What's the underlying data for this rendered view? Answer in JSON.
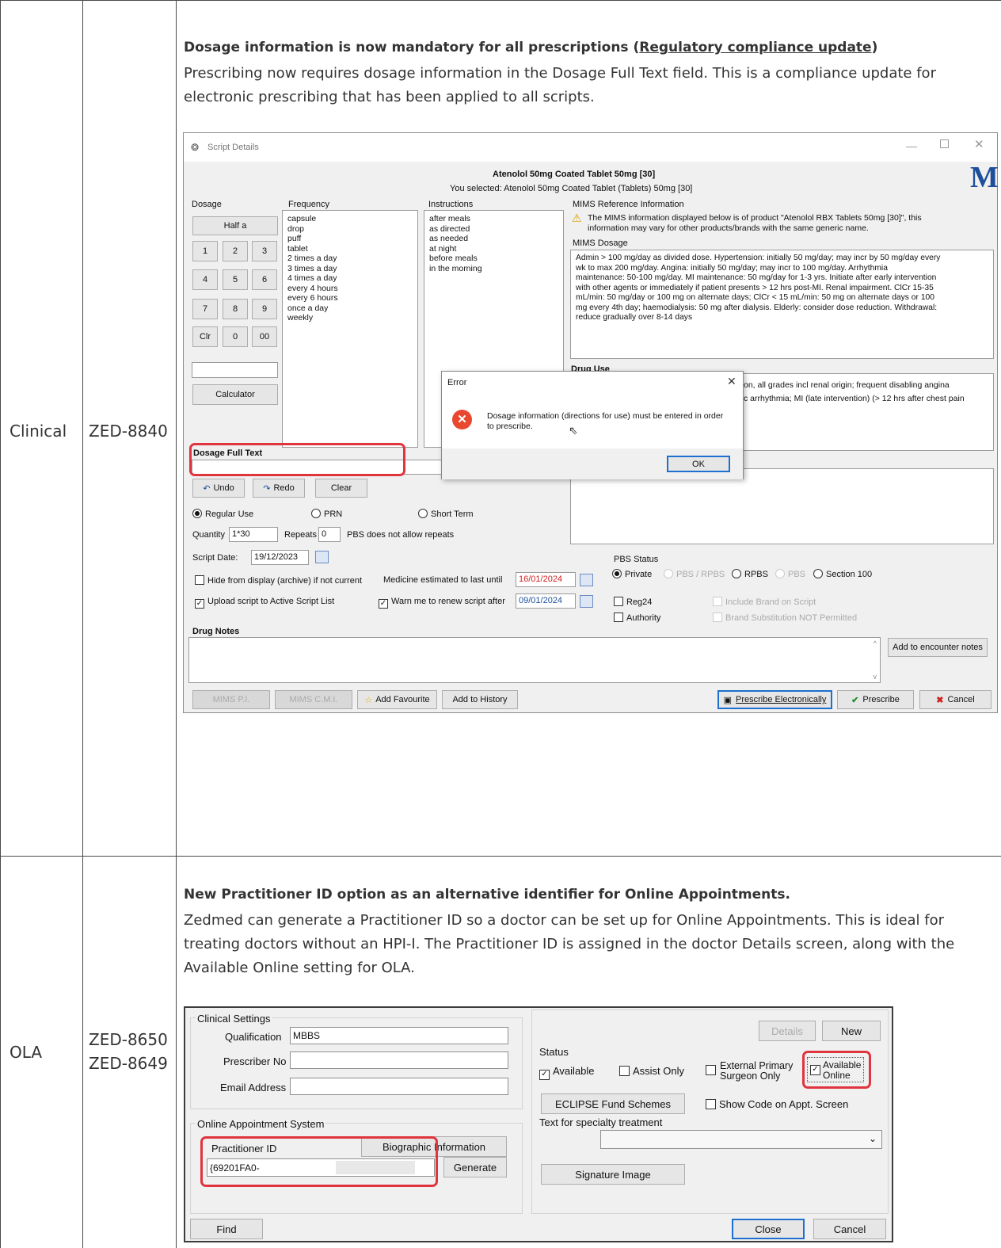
{
  "rows": [
    {
      "category": "Clinical",
      "ids": [
        "ZED-8840"
      ],
      "title_prefix": "Dosage information is now mandatory for all prescriptions (",
      "title_link": "Regulatory compliance update",
      "title_suffix": ")",
      "description_lines": [
        "Prescribing now requires dosage information in the Dosage Full Text field. This is a compliance update for",
        "electronic prescribing that has been applied to all scripts."
      ]
    },
    {
      "category": "OLA",
      "ids": [
        "ZED-8650",
        "ZED-8649"
      ],
      "title": "New Practitioner ID option as an alternative identifier for Online Appointments.",
      "description_lines": [
        "Zedmed can generate a Practitioner ID so a doctor can be set up for Online Appointments. This is ideal for",
        "treating doctors without an HPI-I. The Practitioner ID is assigned in the doctor Details screen, along with the",
        "Available Online setting for OLA."
      ]
    }
  ],
  "script": {
    "window_title": "Script Details",
    "drug_title": "Atenolol 50mg Coated Tablet 50mg [30]",
    "selected": "You selected: Atenolol 50mg Coated Tablet (Tablets) 50mg [30]",
    "logo": "M",
    "dosage_label": "Dosage",
    "half_label": "Half a",
    "keypad": [
      "1",
      "2",
      "3",
      "4",
      "5",
      "6",
      "7",
      "8",
      "9",
      "Clr",
      "0",
      "00"
    ],
    "calculator": "Calculator",
    "frequency_label": "Frequency",
    "frequency_items": [
      "capsule",
      "drop",
      "puff",
      "tablet",
      "2 times a day",
      "3 times a day",
      "4 times a day",
      "every 4 hours",
      "every 6 hours",
      "once a day",
      "weekly"
    ],
    "instructions_label": "Instructions",
    "instructions_items": [
      "after meals",
      "as directed",
      "as needed",
      "at night",
      "before meals",
      "in the morning"
    ],
    "mims_ref_label": "MIMS Reference Information",
    "mims_ref_text_1": "The MIMS information displayed below is of product \"Atenolol RBX Tablets 50mg [30]\", this",
    "mims_ref_text_2": "information may vary for other products/brands with the same generic name.",
    "mims_dosage_label": "MIMS Dosage",
    "mims_dosage_lines": [
      "Admin > 100 mg/day as divided dose. Hypertension: initially 50 mg/day; may incr by 50 mg/day every",
      "wk to max 200 mg/day. Angina: initially 50 mg/day; may incr to 100 mg/day. Arrhythmia",
      "maintenance: 50-100 mg/day. MI maintenance: 50 mg/day for 1-3 yrs. Initiate after early intervention",
      "with other agents or immediately if patient presents > 12 hrs post-MI. Renal impairment. ClCr 15-35",
      "mL/min: 50 mg/day or 100 mg on alternate days; ClCr < 15 mL/min: 50 mg on alternate days or 100",
      "mg every 4th day; haemodialysis: 50 mg after dialysis. Elderly: consider dose reduction. Withdrawal:",
      "reduce gradually over 8-14 days"
    ],
    "drug_use_label": "Drug Use",
    "drug_use_line1": "on, all grades incl renal origin; frequent disabling angina",
    "drug_use_line2": "c arrhythmia; MI (late intervention) (> 12 hrs after chest pain",
    "error_title": "Error",
    "error_msg_1": "Dosage information (directions for use) must be entered in order",
    "error_msg_2": "to prescribe.",
    "ok": "OK",
    "dosage_full_text": "Dosage Full Text",
    "undo": "Undo",
    "redo": "Redo",
    "clear": "Clear",
    "regular_use": "Regular Use",
    "prn": "PRN",
    "short_term": "Short Term",
    "quantity_label": "Quantity",
    "quantity_value": "1*30",
    "repeats_label": "Repeats",
    "repeats_value": "0",
    "pbs_no_repeats": "PBS does not allow repeats",
    "script_date_label": "Script Date:",
    "script_date_value": "19/12/2023",
    "hide_label": "Hide from display (archive) if not current",
    "medicine_last_label": "Medicine estimated to last until",
    "medicine_last_value": "16/01/2024",
    "upload_label": "Upload script to Active Script List",
    "warn_label": "Warn me to renew script after",
    "warn_value": "09/01/2024",
    "pbs_status_label": "PBS Status",
    "pbs_private": "Private",
    "pbs_rpbs_combo": "PBS / RPBS",
    "pbs_rpbs": "RPBS",
    "pbs_pbs": "PBS",
    "pbs_s100": "Section 100",
    "reg24": "Reg24",
    "authority": "Authority",
    "include_brand": "Include Brand on Script",
    "brand_sub": "Brand Substitution NOT Permitted",
    "drug_notes": "Drug Notes",
    "add_encounter": "Add to encounter notes",
    "mims_pi": "MIMS P.I.",
    "mims_cmi": "MIMS C.M.I.",
    "add_favourite": "Add Favourite",
    "add_history": "Add to History",
    "prescribe_elec": "Prescribe Electronically",
    "prescribe": "Prescribe",
    "cancel": "Cancel"
  },
  "doctor": {
    "clinical_settings": "Clinical Settings",
    "qualification_label": "Qualification",
    "qualification_value": "MBBS",
    "prescriber_label": "Prescriber No",
    "email_label": "Email Address",
    "online_system": "Online Appointment System",
    "biographic": "Biographic Information",
    "practitioner_id_label": "Practitioner ID",
    "practitioner_id_value": "{69201FA0-",
    "generate": "Generate",
    "find": "Find",
    "details": "Details",
    "new": "New",
    "status": "Status",
    "available": "Available",
    "assist_only": "Assist Only",
    "external_primary_1": "External Primary",
    "external_primary_2": "Surgeon Only",
    "available_online_1": "Available",
    "available_online_2": "Online",
    "eclipse": "ECLIPSE Fund Schemes",
    "show_code": "Show Code on Appt. Screen",
    "specialty": "Text for specialty treatment",
    "signature": "Signature Image",
    "close": "Close",
    "cancel": "Cancel"
  },
  "colors": {
    "highlight_red": "#e0343e",
    "error_red": "#e8482f",
    "logo_blue": "#1d4f9a"
  }
}
